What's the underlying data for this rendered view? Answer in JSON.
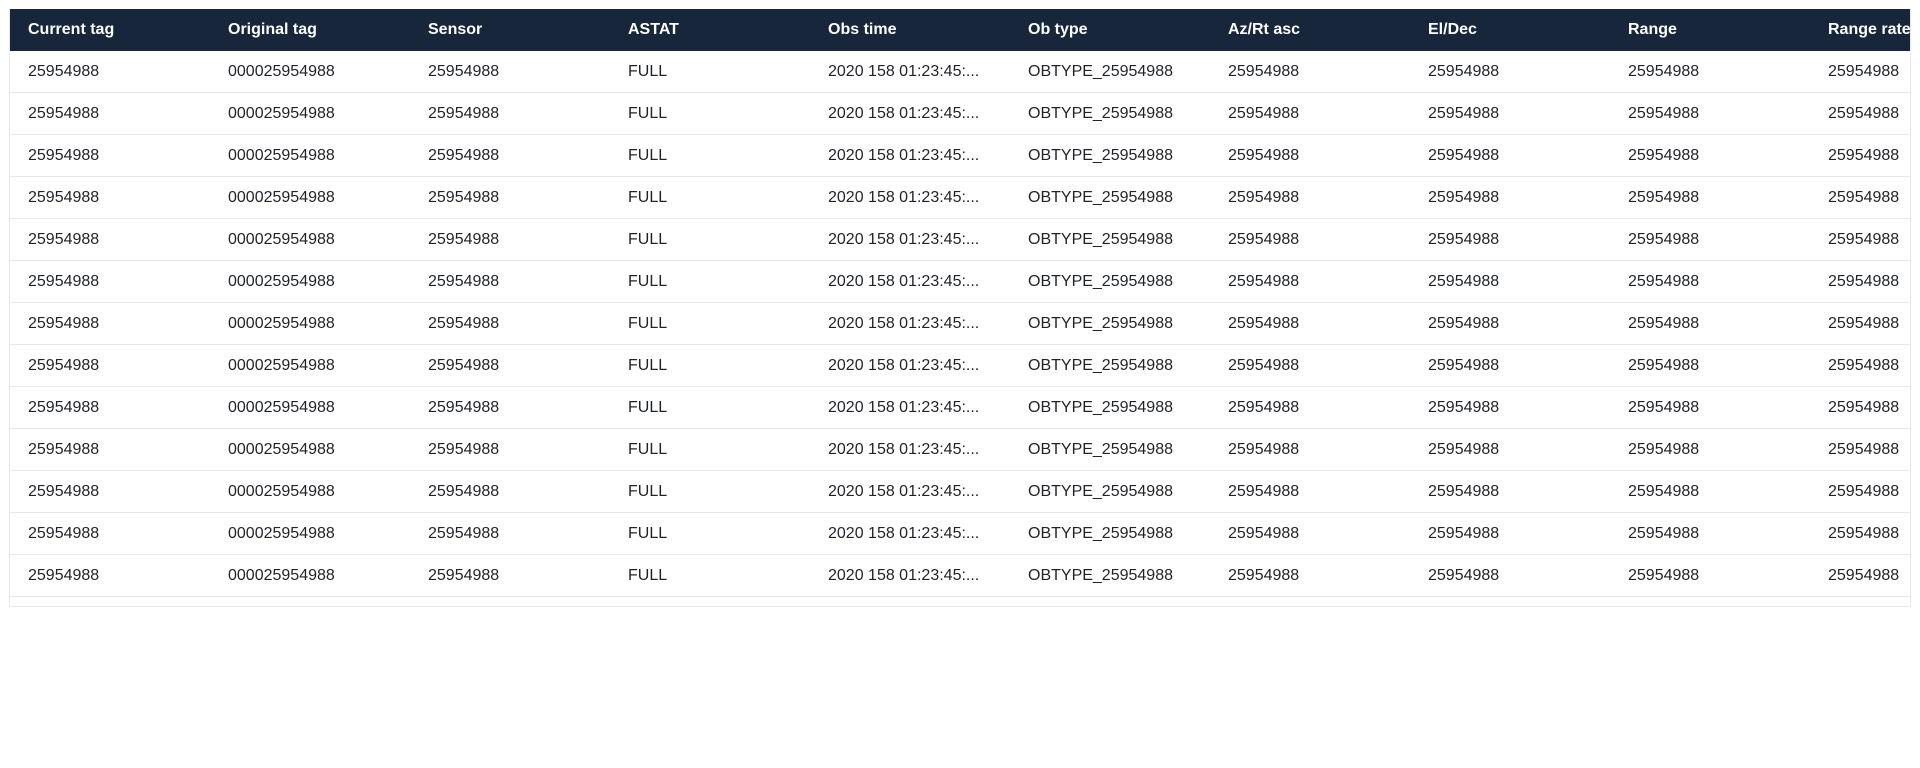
{
  "table": {
    "columns": [
      "Current tag",
      "Original tag",
      "Sensor",
      "ASTAT",
      "Obs time",
      "Ob type",
      "Az/Rt asc",
      "El/Dec",
      "Range",
      "Range rate"
    ],
    "rows": [
      [
        "25954988",
        "000025954988",
        "25954988",
        "FULL",
        "2020 158 01:23:45:...",
        "OBTYPE_25954988",
        "25954988",
        "25954988",
        "25954988",
        "25954988"
      ],
      [
        "25954988",
        "000025954988",
        "25954988",
        "FULL",
        "2020 158 01:23:45:...",
        "OBTYPE_25954988",
        "25954988",
        "25954988",
        "25954988",
        "25954988"
      ],
      [
        "25954988",
        "000025954988",
        "25954988",
        "FULL",
        "2020 158 01:23:45:...",
        "OBTYPE_25954988",
        "25954988",
        "25954988",
        "25954988",
        "25954988"
      ],
      [
        "25954988",
        "000025954988",
        "25954988",
        "FULL",
        "2020 158 01:23:45:...",
        "OBTYPE_25954988",
        "25954988",
        "25954988",
        "25954988",
        "25954988"
      ],
      [
        "25954988",
        "000025954988",
        "25954988",
        "FULL",
        "2020 158 01:23:45:...",
        "OBTYPE_25954988",
        "25954988",
        "25954988",
        "25954988",
        "25954988"
      ],
      [
        "25954988",
        "000025954988",
        "25954988",
        "FULL",
        "2020 158 01:23:45:...",
        "OBTYPE_25954988",
        "25954988",
        "25954988",
        "25954988",
        "25954988"
      ],
      [
        "25954988",
        "000025954988",
        "25954988",
        "FULL",
        "2020 158 01:23:45:...",
        "OBTYPE_25954988",
        "25954988",
        "25954988",
        "25954988",
        "25954988"
      ],
      [
        "25954988",
        "000025954988",
        "25954988",
        "FULL",
        "2020 158 01:23:45:...",
        "OBTYPE_25954988",
        "25954988",
        "25954988",
        "25954988",
        "25954988"
      ],
      [
        "25954988",
        "000025954988",
        "25954988",
        "FULL",
        "2020 158 01:23:45:...",
        "OBTYPE_25954988",
        "25954988",
        "25954988",
        "25954988",
        "25954988"
      ],
      [
        "25954988",
        "000025954988",
        "25954988",
        "FULL",
        "2020 158 01:23:45:...",
        "OBTYPE_25954988",
        "25954988",
        "25954988",
        "25954988",
        "25954988"
      ],
      [
        "25954988",
        "000025954988",
        "25954988",
        "FULL",
        "2020 158 01:23:45:...",
        "OBTYPE_25954988",
        "25954988",
        "25954988",
        "25954988",
        "25954988"
      ],
      [
        "25954988",
        "000025954988",
        "25954988",
        "FULL",
        "2020 158 01:23:45:...",
        "OBTYPE_25954988",
        "25954988",
        "25954988",
        "25954988",
        "25954988"
      ],
      [
        "25954988",
        "000025954988",
        "25954988",
        "FULL",
        "2020 158 01:23:45:...",
        "OBTYPE_25954988",
        "25954988",
        "25954988",
        "25954988",
        "25954988"
      ]
    ]
  },
  "colors": {
    "header_bg": "#17263a",
    "header_text": "#ffffff",
    "row_border": "#e6e8eb",
    "cell_text": "#1f2328"
  }
}
